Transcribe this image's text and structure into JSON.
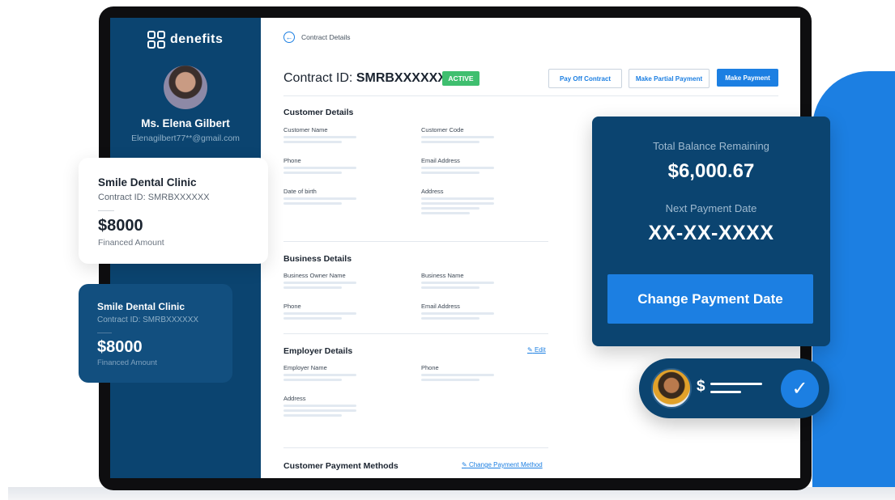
{
  "brand": {
    "name": "denefits"
  },
  "user": {
    "name": "Ms. Elena Gilbert",
    "email": "Elenagilbert77**@gmail.com"
  },
  "breadcrumb": {
    "label": "Contract Details"
  },
  "contract": {
    "label": "Contract ID:",
    "id": "SMRBXXXXXX",
    "status": "ACTIVE"
  },
  "actions": {
    "pay_off": "Pay Off Contract",
    "partial": "Make Partial Payment",
    "make_payment": "Make Payment"
  },
  "customer_details": {
    "title": "Customer Details",
    "fields": [
      "Customer Name",
      "Customer Code",
      "Phone",
      "Email Address",
      "Date of birth",
      "Address"
    ]
  },
  "business_details": {
    "title": "Business Details",
    "fields": [
      "Business Owner Name",
      "Business Name",
      "Phone",
      "Email Address"
    ]
  },
  "employer_details": {
    "title": "Employer Details",
    "edit": "Edit",
    "fields": [
      "Employer Name",
      "Phone",
      "Address"
    ]
  },
  "payment_methods": {
    "title": "Customer Payment Methods",
    "change": "Change Payment Method"
  },
  "clinic_card_white": {
    "name": "Smile Dental Clinic",
    "contract_label": "Contract ID:",
    "contract_id": "SMRBXXXXXX",
    "amount": "$8000",
    "amount_label": "Financed Amount"
  },
  "clinic_card_blue": {
    "name": "Smile Dental Clinic",
    "contract_label": "Contract ID:",
    "contract_id": "SMRBXXXXXX",
    "amount": "$8000",
    "amount_label": "Financed Amount"
  },
  "balance": {
    "label": "Total Balance Remaining",
    "value": "$6,000.67",
    "next_label": "Next Payment Date",
    "next_value": "XX-XX-XXXX",
    "button": "Change Payment Date"
  },
  "payment_pill": {
    "symbol": "$",
    "check_icon": "check-icon"
  },
  "colors": {
    "sidebar": "#0b4470",
    "accent": "#1c7fe2",
    "active_badge": "#3fbf6f"
  }
}
